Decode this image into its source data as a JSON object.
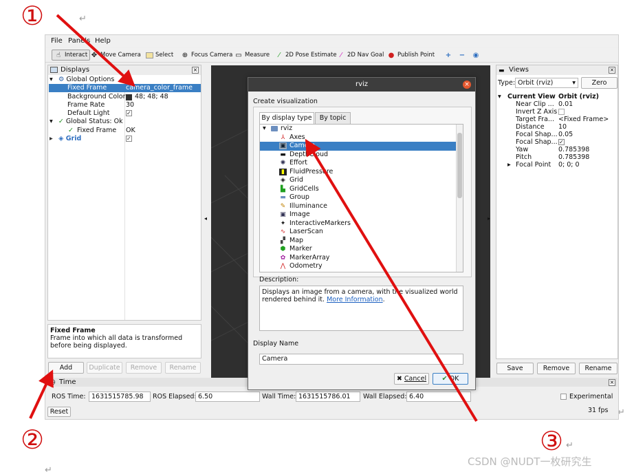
{
  "annotations": {
    "marker_1": "①",
    "marker_2": "②",
    "marker_3": "③",
    "paragraph_mark": "↵",
    "watermark": "CSDN @NUDT一枚研究生",
    "arrow_color": "#e01010"
  },
  "menubar": {
    "file": "File",
    "panels": "Panels",
    "help": "Help"
  },
  "toolbar": {
    "interact": "Interact",
    "move_camera": "Move Camera",
    "select": "Select",
    "focus_camera": "Focus Camera",
    "measure": "Measure",
    "pose_estimate": "2D Pose Estimate",
    "nav_goal": "2D Nav Goal",
    "publish_point": "Publish Point"
  },
  "displays_panel": {
    "title": "Displays",
    "rows": [
      {
        "label": "Global Options",
        "value": ""
      },
      {
        "label": "Fixed Frame",
        "value": "camera_color_frame"
      },
      {
        "label": "Background Color",
        "value": "48; 48; 48"
      },
      {
        "label": "Frame Rate",
        "value": "30"
      },
      {
        "label": "Default Light",
        "value": "✓"
      },
      {
        "label": "Global Status: Ok",
        "value": ""
      },
      {
        "label": "Fixed Frame",
        "value": "OK"
      },
      {
        "label": "Grid",
        "value": "✓"
      }
    ],
    "help_title": "Fixed Frame",
    "help_text": "Frame into which all data is transformed before being displayed.",
    "buttons": {
      "add": "Add",
      "duplicate": "Duplicate",
      "remove": "Remove",
      "rename": "Rename"
    }
  },
  "views_panel": {
    "title": "Views",
    "type_label": "Type:",
    "type_value": "Orbit (rviz)",
    "zero_button": "Zero",
    "rows": [
      {
        "label": "Current View",
        "value": "Orbit (rviz)"
      },
      {
        "label": "Near Clip ...",
        "value": "0.01"
      },
      {
        "label": "Invert Z Axis",
        "value": ""
      },
      {
        "label": "Target Fra...",
        "value": "<Fixed Frame>"
      },
      {
        "label": "Distance",
        "value": "10"
      },
      {
        "label": "Focal Shap...",
        "value": "0.05"
      },
      {
        "label": "Focal Shap...",
        "value": "✓"
      },
      {
        "label": "Yaw",
        "value": "0.785398"
      },
      {
        "label": "Pitch",
        "value": "0.785398"
      },
      {
        "label": "Focal Point",
        "value": "0; 0; 0"
      }
    ],
    "buttons": {
      "save": "Save",
      "remove": "Remove",
      "rename": "Rename"
    }
  },
  "time_panel": {
    "title": "Time",
    "ros_time_label": "ROS Time:",
    "ros_time": "1631515785.98",
    "ros_elapsed_label": "ROS Elapsed:",
    "ros_elapsed": "6.50",
    "wall_time_label": "Wall Time:",
    "wall_time": "1631515786.01",
    "wall_elapsed_label": "Wall Elapsed:",
    "wall_elapsed": "6.40",
    "experimental": "Experimental",
    "reset": "Reset",
    "fps": "31 fps"
  },
  "dialog": {
    "title": "rviz",
    "heading": "Create visualization",
    "tab_display_type": "By display type",
    "tab_topic": "By topic",
    "root": "rviz",
    "items": [
      "Axes",
      "Camera",
      "DepthCloud",
      "Effort",
      "FluidPressure",
      "Grid",
      "GridCells",
      "Group",
      "Illuminance",
      "Image",
      "InteractiveMarkers",
      "LaserScan",
      "Map",
      "Marker",
      "MarkerArray",
      "Odometry"
    ],
    "selected": "Camera",
    "description_label": "Description:",
    "description_text": "Displays an image from a camera, with the visualized world rendered behind it.",
    "more_info": "More Information",
    "description_end": ".",
    "display_name_label": "Display Name",
    "display_name_value": "Camera",
    "cancel": "Cancel",
    "ok": "OK"
  }
}
